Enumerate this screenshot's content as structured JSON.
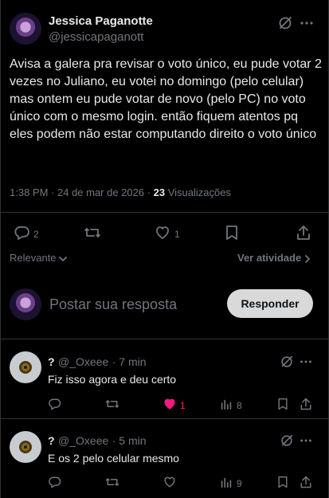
{
  "post": {
    "author_name": "Jessica Paganotte",
    "author_handle": "@jessicapaganott",
    "text": "Avisa a galera pra revisar o voto único, eu pude votar 2 vezes no Juliano, eu votei no domingo (pelo celular) mas ontem eu pude votar de novo (pelo PC) no voto único com o mesmo login. então fiquem atentos pq eles podem não estar computando direito o voto único",
    "time": "1:38 PM · 24 de mar de 2026 · ",
    "views_count": "23",
    "views_label": " Visualizações",
    "reply_count": "2",
    "like_count": "1"
  },
  "sort": {
    "label": "Relevante",
    "activity_label": "Ver atividade"
  },
  "composer": {
    "placeholder": "Postar sua resposta",
    "button_label": "Responder"
  },
  "replies": [
    {
      "name": "?",
      "handle": "@_Oxeee",
      "time": "· 7 min",
      "text": "Fiz isso agora e deu certo",
      "like_count": "1",
      "views": "8",
      "liked": true
    },
    {
      "name": "?",
      "handle": "@_Oxeee",
      "time": "· 5 min",
      "text": "E os 2 pelo celular mesmo",
      "like_count": "",
      "views": "9",
      "liked": false
    }
  ],
  "colors": {
    "background": "#000000",
    "text_primary": "#e7e9ea",
    "text_secondary": "#71767b",
    "liked_heart": "#f91880",
    "divider": "#2f3336",
    "button_bg": "#d9d9d9"
  },
  "icons": [
    "grok-icon",
    "more-icon",
    "reply-icon",
    "retweet-icon",
    "like-icon",
    "bookmark-icon",
    "share-icon",
    "views-icon",
    "chevron-down-icon",
    "chevron-right-icon"
  ]
}
